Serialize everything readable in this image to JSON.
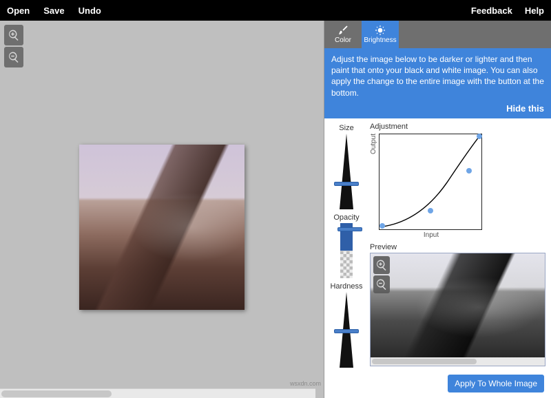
{
  "menu": {
    "open": "Open",
    "save": "Save",
    "undo": "Undo",
    "feedback": "Feedback",
    "help": "Help"
  },
  "tabs": {
    "color": "Color",
    "brightness": "Brightness",
    "active": "brightness"
  },
  "info": {
    "text": "Adjust the image below to be darker or lighter and then paint that onto your black and white image. You can also apply the change to the entire image with the button at the bottom.",
    "hide": "Hide this"
  },
  "sliders": {
    "size_label": "Size",
    "size_value": 0.65,
    "opacity_label": "Opacity",
    "opacity_value": 0.92,
    "hardness_label": "Hardness",
    "hardness_value": 0.5
  },
  "adjustment": {
    "label": "Adjustment",
    "output_label": "Output",
    "input_label": "Input",
    "points": [
      {
        "x": 0.03,
        "y": 0.04
      },
      {
        "x": 0.5,
        "y": 0.2
      },
      {
        "x": 0.88,
        "y": 0.62
      },
      {
        "x": 0.98,
        "y": 0.98
      }
    ]
  },
  "preview": {
    "label": "Preview"
  },
  "apply": {
    "label": "Apply To Whole Image"
  },
  "watermark": "wsxdn.com",
  "colors": {
    "accent": "#3f84db",
    "topbar": "#000000",
    "panel": "#6f6f6f"
  }
}
